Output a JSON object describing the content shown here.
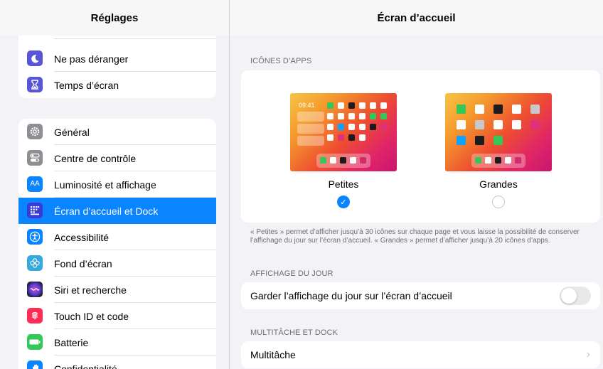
{
  "sidebar": {
    "title": "Réglages",
    "group1": [
      {
        "label": "",
        "icon": "partial-red-icon",
        "color": "#ff3b30"
      },
      {
        "label": "Ne pas déranger",
        "icon": "moon-icon",
        "color": "#5856d6"
      },
      {
        "label": "Temps d’écran",
        "icon": "hourglass-icon",
        "color": "#5856d6"
      }
    ],
    "group2": [
      {
        "label": "Général",
        "icon": "gear-icon",
        "color": "#8e8e93"
      },
      {
        "label": "Centre de contrôle",
        "icon": "toggles-icon",
        "color": "#8e8e93"
      },
      {
        "label": "Luminosité et affichage",
        "icon": "text-size-icon",
        "color": "#0a84ff",
        "glyph": "AA"
      },
      {
        "label": "Écran d’accueil et Dock",
        "icon": "app-grid-icon",
        "color": "#3a3ad6",
        "selected": true
      },
      {
        "label": "Accessibilité",
        "icon": "accessibility-icon",
        "color": "#0a84ff"
      },
      {
        "label": "Fond d’écran",
        "icon": "flower-icon",
        "color": "#34aadc"
      },
      {
        "label": "Siri et recherche",
        "icon": "siri-icon",
        "color": "#1c1c1e"
      },
      {
        "label": "Touch ID et code",
        "icon": "fingerprint-icon",
        "color": "#ff2d55"
      },
      {
        "label": "Batterie",
        "icon": "battery-icon",
        "color": "#34c759"
      },
      {
        "label": "Confidentialité",
        "icon": "hand-icon",
        "color": "#0a84ff"
      }
    ]
  },
  "main": {
    "title": "Écran d’accueil",
    "section_icons": "ICÔNES D’APPS",
    "option_small": {
      "label": "Petites",
      "time": "09:41",
      "selected": true
    },
    "option_large": {
      "label": "Grandes",
      "selected": false
    },
    "note": "« Petites » permet d’afficher jusqu’à 30 icônes sur chaque page et vous laisse la possibilité de conserver l’affichage du jour sur l’écran d’accueil. « Grandes » permet d’afficher jusqu’à 20 icônes d’apps.",
    "section_today": "AFFICHAGE DU JOUR",
    "keep_today_label": "Garder l’affichage du jour sur l’écran d’accueil",
    "keep_today_on": false,
    "section_multitask": "MULTITÂCHE ET DOCK",
    "multitask_label": "Multitâche"
  }
}
